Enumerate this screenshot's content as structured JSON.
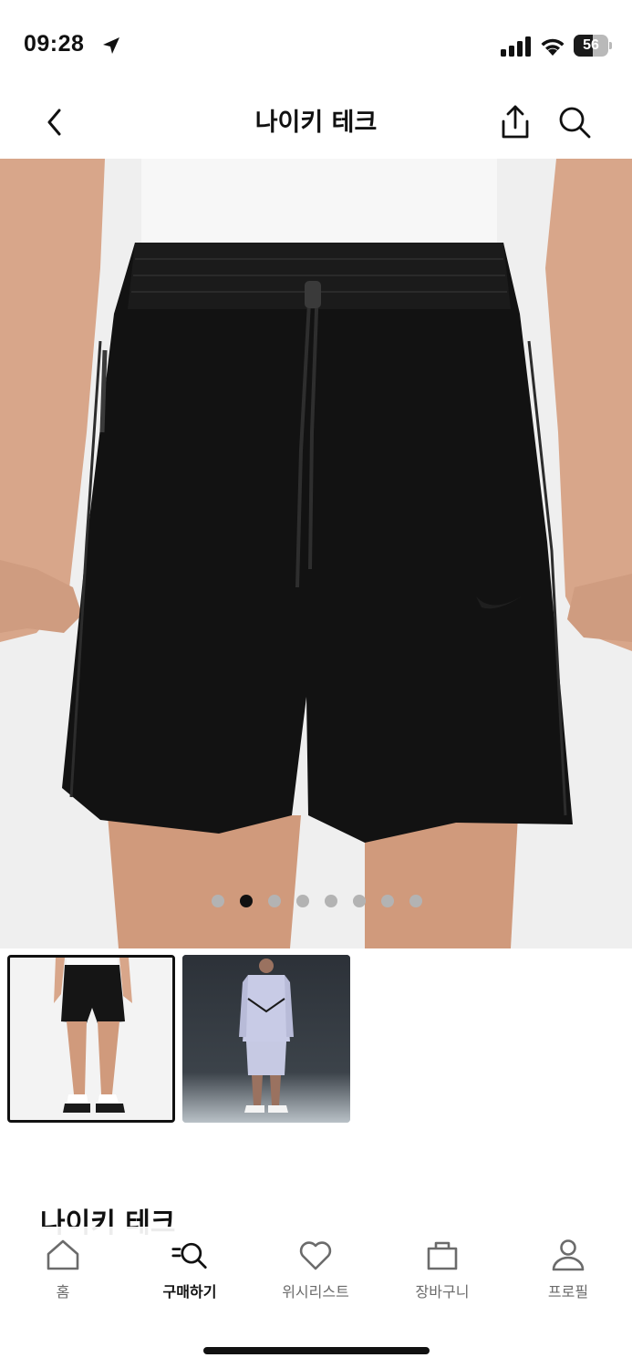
{
  "status_bar": {
    "time": "09:28",
    "battery_level": 56,
    "battery_text": "56",
    "icons": [
      "location-arrow-icon",
      "cellular-signal-icon",
      "wifi-icon",
      "battery-icon"
    ]
  },
  "header": {
    "title": "나이키 테크",
    "icons": [
      "back-chevron-icon",
      "share-icon",
      "search-icon"
    ]
  },
  "gallery": {
    "image_count": 8,
    "active_index": 1,
    "thumbnails": [
      {
        "name": "black-woven-shorts-front",
        "selected": true
      },
      {
        "name": "model-in-grey-tech-fleece-set",
        "selected": false
      }
    ]
  },
  "product": {
    "name": "나이키 테크"
  },
  "tab_bar": {
    "items": [
      {
        "label": "홈",
        "icon": "home-icon",
        "active": false
      },
      {
        "label": "구매하기",
        "icon": "shop-search-icon",
        "active": true
      },
      {
        "label": "위시리스트",
        "icon": "heart-icon",
        "active": false
      },
      {
        "label": "장바구니",
        "icon": "bag-icon",
        "active": false
      },
      {
        "label": "프로필",
        "icon": "profile-icon",
        "active": false
      }
    ]
  },
  "colors": {
    "text": "#111111",
    "inactive": "#6b6b6b",
    "dot_inactive": "#b3b3b3",
    "hero_bg": "#efefef"
  }
}
